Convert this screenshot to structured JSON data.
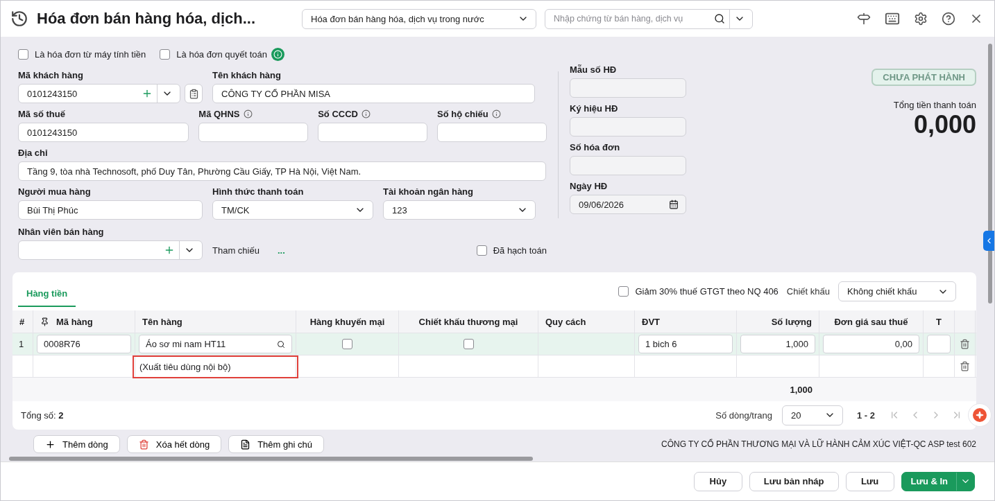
{
  "header": {
    "title": "Hóa đơn bán hàng hóa, dịch...",
    "document_type": "Hóa đơn bán hàng hóa, dịch vụ trong nước",
    "search_placeholder": "Nhập chứng từ bán hàng, dịch vụ"
  },
  "options": [
    {
      "label": "Là hóa đơn từ máy tính tiền",
      "checked": false,
      "info": false
    },
    {
      "label": "Là hóa đơn quyết toán",
      "checked": false,
      "info": true
    }
  ],
  "form_rows": [
    [
      {
        "label": "Mã khách hàng",
        "value": "0101243150",
        "kind": "combo_lookup",
        "info": false,
        "disabled": false
      },
      {
        "label": "Tên khách hàng",
        "value": "CÔNG TY CỔ PHẦN MISA",
        "kind": "text",
        "info": false,
        "disabled": false
      }
    ],
    [
      {
        "label": "Mã số thuế",
        "value": "0101243150",
        "kind": "text",
        "info": false,
        "disabled": false
      },
      {
        "label": "Mã QHNS",
        "kind": "text",
        "info": true,
        "disabled": false
      },
      {
        "label": "Số CCCD",
        "kind": "text",
        "info": true,
        "disabled": false
      },
      {
        "label": "Số hộ chiếu",
        "kind": "text",
        "info": true,
        "disabled": false
      }
    ],
    [
      {
        "label": "Địa chỉ",
        "value": "Tầng 9, tòa nhà Technosoft, phố Duy Tân, Phường Cầu Giấy, TP Hà Nội, Việt Nam.",
        "kind": "text",
        "info": false,
        "disabled": false
      }
    ],
    [
      {
        "label": "Người mua hàng",
        "value": "Bùi Thị Phúc",
        "kind": "text",
        "info": false,
        "disabled": false
      },
      {
        "label": "Hình thức thanh toán",
        "value": "TM/CK",
        "kind": "select",
        "info": false,
        "disabled": false
      },
      {
        "label": "Tài khoản ngân hàng",
        "value": "123",
        "kind": "select",
        "info": false,
        "disabled": false
      }
    ]
  ],
  "salesperson": {
    "label": "Nhân viên bán hàng"
  },
  "reference": {
    "label": "Tham chiếu",
    "link": "..."
  },
  "posted": {
    "label": "Đã hạch toán",
    "checked": false
  },
  "invoice_fields": [
    {
      "label": "Mẫu số HĐ",
      "kind": "text",
      "disabled": true
    },
    {
      "label": "Ký hiệu HĐ",
      "kind": "text",
      "disabled": true
    },
    {
      "label": "Số hóa đơn",
      "kind": "text",
      "disabled": true
    },
    {
      "label": "Ngày HĐ",
      "value": "09/06/2026",
      "kind": "date",
      "disabled": true
    }
  ],
  "status": "CHƯA PHÁT HÀNH",
  "total": {
    "label": "Tổng tiền thanh toán",
    "value": "0,000"
  },
  "detail": {
    "tabs": [
      {
        "label": "Hàng tiền",
        "selected": true
      }
    ],
    "vat_option": {
      "label": "Giảm 30% thuế GTGT theo NQ 406",
      "checked": false
    },
    "discount": {
      "label": "Chiết khấu",
      "value": "Không chiết khấu"
    },
    "columns": [
      {
        "label": "#",
        "kind": "index"
      },
      {
        "label": "Mã hàng",
        "kind": "pinned"
      },
      {
        "label": "Tên hàng",
        "kind": "text"
      },
      {
        "label": "Hàng khuyến mại",
        "kind": "center"
      },
      {
        "label": "Chiết khấu thương mại",
        "kind": "center"
      },
      {
        "label": "Quy cách",
        "kind": "text"
      },
      {
        "label": "ĐVT",
        "kind": "text"
      },
      {
        "label": "Số lượng",
        "kind": "number",
        "total": "1,000"
      },
      {
        "label": "Đơn giá sau thuế",
        "kind": "center"
      },
      {
        "label": "T",
        "kind": "center"
      }
    ],
    "rows": [
      {
        "selected": true,
        "cells": [
          {
            "kind": "plain",
            "value": "1"
          },
          {
            "kind": "input",
            "value": "0008R76"
          },
          {
            "kind": "lookup",
            "value": "Áo sơ mi nam HT11"
          },
          {
            "kind": "checkbox",
            "checked": false
          },
          {
            "kind": "checkbox",
            "checked": false
          },
          {
            "kind": "empty"
          },
          {
            "kind": "input",
            "value": "1 bich 6"
          },
          {
            "kind": "number",
            "value": "1,000"
          },
          {
            "kind": "number",
            "value": "0,00"
          },
          {
            "kind": "input"
          }
        ]
      },
      {
        "selected": false,
        "cells": [
          {
            "kind": "empty"
          },
          {
            "kind": "empty"
          },
          {
            "kind": "note",
            "value": "(Xuất tiêu dùng nội bộ)",
            "highlighted": true
          },
          {
            "kind": "empty"
          },
          {
            "kind": "empty"
          },
          {
            "kind": "empty"
          },
          {
            "kind": "empty"
          },
          {
            "kind": "empty"
          },
          {
            "kind": "empty"
          },
          {
            "kind": "empty"
          }
        ]
      }
    ],
    "count": "Tổng số: **2**",
    "page_size": {
      "label": "Số dòng/trang",
      "value": "20"
    },
    "range": "1 - 2",
    "actions": [
      {
        "label": "Thêm dòng",
        "kind": "add"
      },
      {
        "label": "Xóa hết dòng",
        "kind": "delete"
      },
      {
        "label": "Thêm ghi chú",
        "kind": "note"
      }
    ],
    "company": "CÔNG TY CỔ PHẦN THƯƠNG MẠI VÀ LỮ HÀNH CẢM XÚC VIỆT-QC ASP test 602"
  },
  "buttons": [
    {
      "label": "Hủy",
      "kind": "default"
    },
    {
      "label": "Lưu bản nháp",
      "kind": "default"
    },
    {
      "label": "Lưu",
      "kind": "default"
    },
    {
      "label": "Lưu & In",
      "kind": "primary"
    }
  ]
}
